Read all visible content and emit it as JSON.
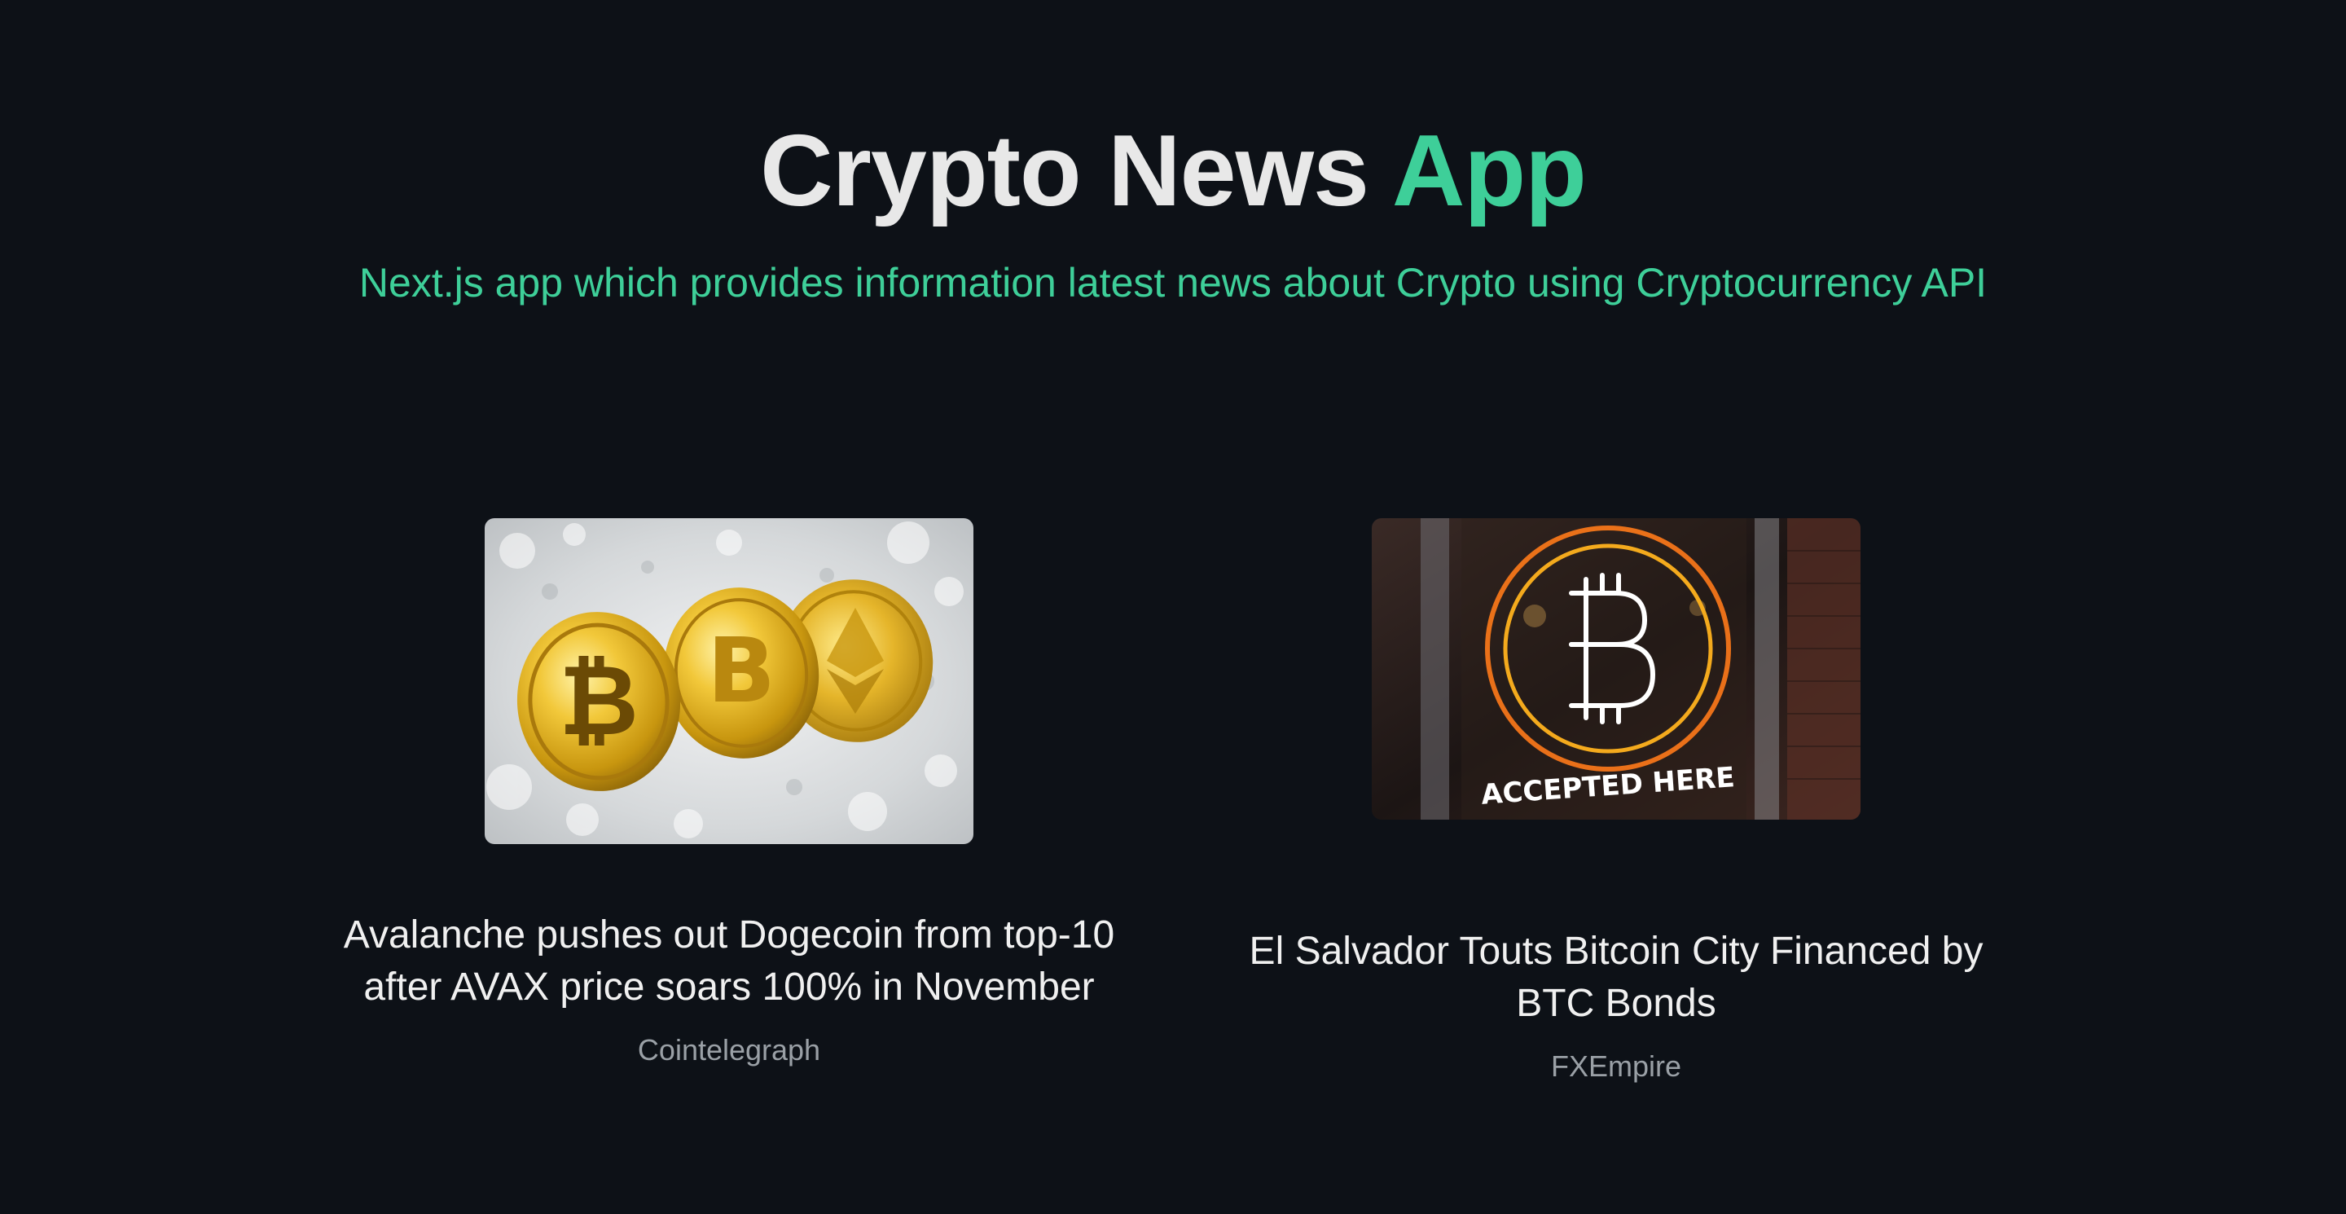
{
  "header": {
    "title_main": "Crypto News",
    "title_accent": "App",
    "subtitle": "Next.js app which provides information latest news about Crypto using Cryptocurrency API"
  },
  "articles": [
    {
      "title": "Avalanche pushes out Dogecoin from top-10 after AVAX price soars 100% in November",
      "source": "Cointelegraph",
      "image": "gold-crypto-coins-in-snow"
    },
    {
      "title": "El Salvador Touts Bitcoin City Financed by BTC Bonds",
      "source": "FXEmpire",
      "image": "neon-bitcoin-sign",
      "image_caption": "ACCEPTED HERE"
    }
  ],
  "colors": {
    "background": "#0d1117",
    "accent": "#3ecf99",
    "title_text": "#e8e8e8",
    "muted_text": "#9aa0a6"
  }
}
